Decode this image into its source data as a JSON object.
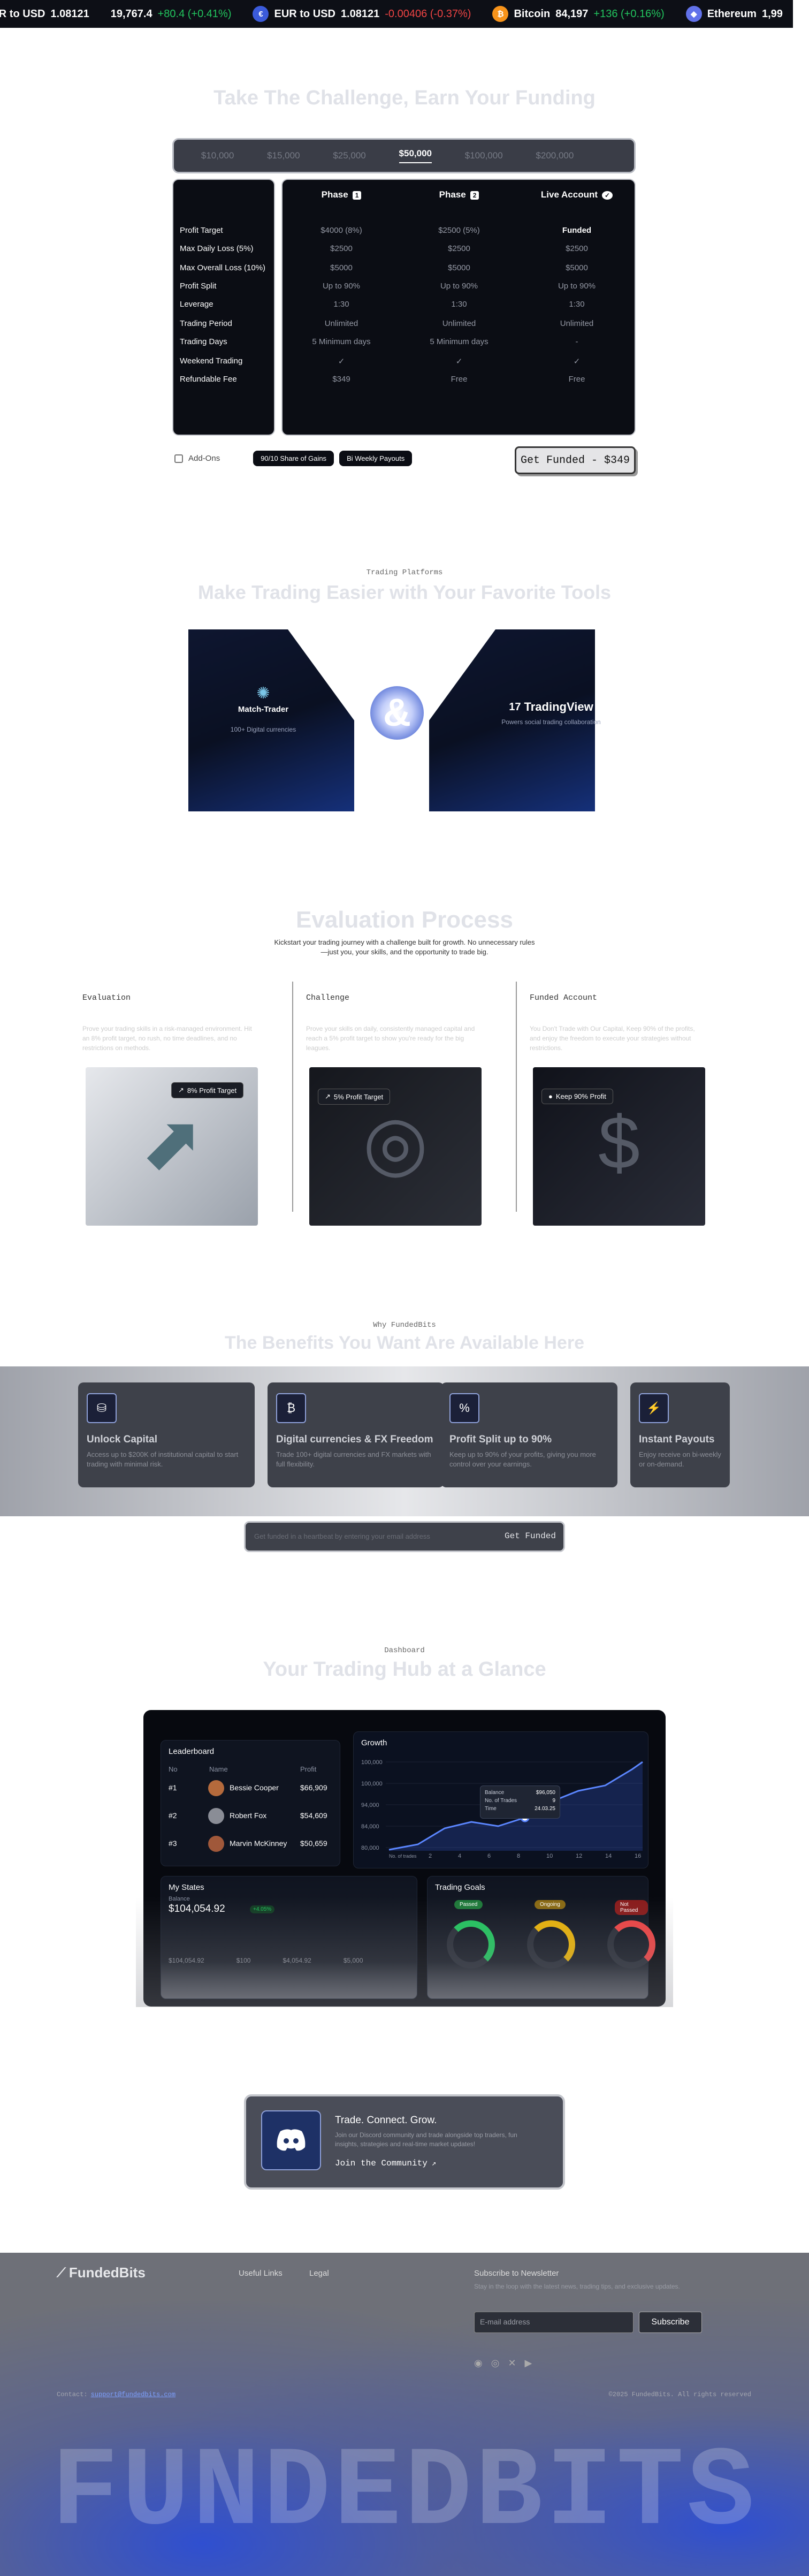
{
  "ticker": [
    {
      "label": "EUR to USD",
      "price": "1.08121",
      "change": "",
      "dir": "",
      "coin": "",
      "color": ""
    },
    {
      "label": "",
      "price": "19,767.4",
      "change": "+80.4 (+0.41%)",
      "dir": "up",
      "coin": "",
      "color": ""
    },
    {
      "label": "EUR to USD",
      "price": "1.08121",
      "change": "-0.00406 (-0.37%)",
      "dir": "down",
      "coin": "€",
      "color": "#3b5bdb"
    },
    {
      "label": "Bitcoin",
      "price": "84,197",
      "change": "+136 (+0.16%)",
      "dir": "up",
      "coin": "₿",
      "color": "#f7931a"
    },
    {
      "label": "Ethereum",
      "price": "1,99",
      "change": "",
      "dir": "",
      "coin": "◆",
      "color": "#6272ea"
    }
  ],
  "challenge": {
    "title": "Take The Challenge, Earn Your Funding",
    "tabs": [
      "$10,000",
      "$15,000",
      "$25,000",
      "$50,000",
      "$100,000",
      "$200,000"
    ],
    "active_tab": "$50,000",
    "row_labels": [
      "Profit Target",
      "Max Daily Loss (5%)",
      "Max Overall Loss (10%)",
      "Profit Split",
      "Leverage",
      "Trading Period",
      "Trading Days",
      "Weekend Trading",
      "Refundable Fee"
    ],
    "columns": [
      {
        "name": "Phase",
        "num": "1",
        "values": [
          "$4000 (8%)",
          "$2500",
          "$5000",
          "Up to 90%",
          "1:30",
          "Unlimited",
          "5 Minimum days",
          "✓",
          "$349"
        ]
      },
      {
        "name": "Phase",
        "num": "2",
        "values": [
          "$2500 (5%)",
          "$2500",
          "$5000",
          "Up to 90%",
          "1:30",
          "Unlimited",
          "5 Minimum days",
          "✓",
          "Free"
        ]
      },
      {
        "name": "Live Account",
        "num": "✓",
        "values": [
          "Funded",
          "$2500",
          "$5000",
          "Up to 90%",
          "1:30",
          "Unlimited",
          "-",
          "✓",
          "Free"
        ]
      }
    ],
    "addons_label": "Add-Ons",
    "addon_pills": [
      "90/10 Share of Gains",
      "Bi Weekly Payouts"
    ],
    "cta": "Get Funded - $349"
  },
  "platforms": {
    "eyebrow": "Trading Platforms",
    "title": "Make Trading Easier with Your Favorite Tools",
    "left_name": "Match-Trader",
    "left_desc": "100+ Digital currencies",
    "amp": "&",
    "right_name": "TradingView",
    "right_desc": "Powers social trading collaboration"
  },
  "evaluation": {
    "title": "Evaluation Process",
    "subtitle": "Kickstart your trading journey with a challenge built for growth. No unnecessary rules—just you, your skills, and the opportunity to trade big.",
    "steps": [
      {
        "title": "Evaluation",
        "desc": "Prove your trading skills in a risk-managed environment. Hit an 8% profit target, no rush, no time deadlines, and no restrictions on methods.",
        "badge": "8% Profit Target"
      },
      {
        "title": "Challenge",
        "desc": "Prove your skills on daily, consistently managed capital and reach a 5% profit target to show you're ready for the big leagues.",
        "badge": "5% Profit Target"
      },
      {
        "title": "Funded Account",
        "desc": "You Don't Trade with Our Capital, Keep 90% of the profits, and enjoy the freedom to execute your strategies without restrictions.",
        "badge": "Keep 90% Profit"
      }
    ]
  },
  "benefits": {
    "eyebrow": "Why FundedBits",
    "title": "The Benefits You Want Are Available Here",
    "cards": [
      {
        "title": "Unlock Capital",
        "desc": "Access up to $200K of institutional capital to start trading with minimal risk."
      },
      {
        "title": "Digital currencies & FX Freedom",
        "desc": "Trade 100+ digital currencies and FX markets with full flexibility."
      },
      {
        "title": "Profit Split up to 90%",
        "desc": "Keep up to 90% of your profits, giving you more control over your earnings."
      },
      {
        "title": "Instant Payouts",
        "desc": "Enjoy receive on bi-weekly or on-demand."
      }
    ],
    "email_placeholder": "Get funded in a heartbeat by entering your email address",
    "email_button": "Get Funded"
  },
  "dashboard": {
    "eyebrow": "Dashboard",
    "title": "Your Trading Hub at a Glance",
    "leaderboard": {
      "title": "Leaderboard",
      "headers": [
        "No",
        "Name",
        "Profit"
      ],
      "rows": [
        {
          "no": "#1",
          "name": "Bessie Cooper",
          "profit": "$66,909"
        },
        {
          "no": "#2",
          "name": "Robert Fox",
          "profit": "$54,609"
        },
        {
          "no": "#3",
          "name": "Marvin McKinney",
          "profit": "$50,659"
        }
      ]
    },
    "growth": {
      "title": "Growth",
      "yticks": [
        "100,000",
        "100,000",
        "94,000",
        "84,000",
        "80,000"
      ],
      "xlabel": "No. of trades",
      "xticks": [
        "2",
        "4",
        "6",
        "8",
        "10",
        "12",
        "14",
        "16"
      ],
      "tooltip": {
        "balance_label": "Balance",
        "balance": "$96,050",
        "trades_label": "No. of Trades",
        "trades": "9",
        "time_label": "Time",
        "time": "24.03.25"
      }
    },
    "states": {
      "title": "My States",
      "balance_label": "Balance",
      "balance": "$104,054.92",
      "badge": "+4.05%",
      "items": [
        "$104,054.92",
        "$100",
        "$4,054.92",
        "$5,000"
      ]
    },
    "goals": {
      "title": "Trading Goals",
      "pills": [
        "Passed",
        "Ongoing",
        "Not Passed"
      ]
    }
  },
  "community": {
    "title": "Trade. Connect. Grow.",
    "desc": "Join our Discord community and trade alongside top traders, fun insights, strategies and real-time market updates!",
    "cta": "Join the Community"
  },
  "footer": {
    "brand": "FundedBits",
    "links_title": "Useful Links",
    "legal_title": "Legal",
    "newsletter_title": "Subscribe to Newsletter",
    "newsletter_desc": "Stay in the loop with the latest news, trading tips, and exclusive updates.",
    "email_placeholder": "E-mail address",
    "subscribe": "Subscribe",
    "contact_label": "Contact:",
    "contact_email": "support@fundedbits.com",
    "copyright": "©2025 FundedBits. All rights reserved",
    "big_word": "FUNDEDBITS"
  }
}
